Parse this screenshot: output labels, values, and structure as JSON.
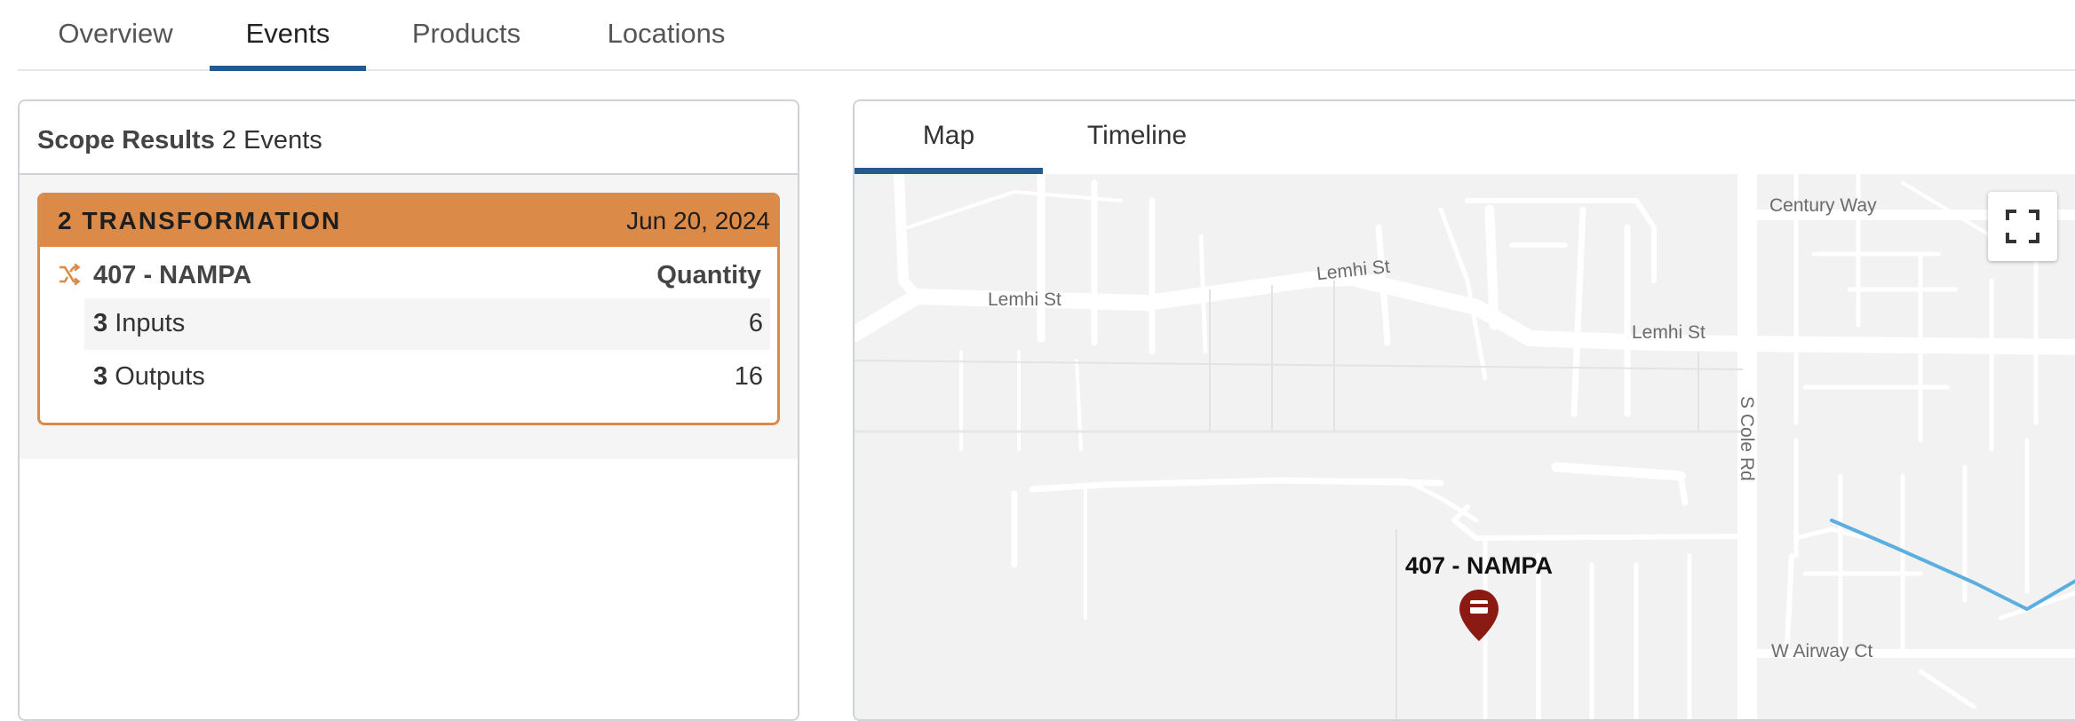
{
  "top_tabs": [
    {
      "label": "Overview"
    },
    {
      "label": "Events"
    },
    {
      "label": "Products"
    },
    {
      "label": "Locations"
    }
  ],
  "scope": {
    "title": "Scope Results",
    "count": "2 Events"
  },
  "event": {
    "type": "2 TRANSFORMATION",
    "date": "Jun 20, 2024",
    "location": "407 - NAMPA",
    "quantity_label": "Quantity",
    "inputs": {
      "count": "3",
      "label": " Inputs",
      "value": "6"
    },
    "outputs": {
      "count": "3",
      "label": " Outputs",
      "value": "16"
    },
    "accent_color": "#dc8a47"
  },
  "map_tabs": [
    {
      "label": "Map"
    },
    {
      "label": "Timeline"
    }
  ],
  "map": {
    "streets": {
      "century": "Century Way",
      "lemhi_1": "Lemhi St",
      "lemhi_2": "Lemhi St",
      "lemhi_3": "Lemhi St",
      "cole": "S Cole Rd",
      "airway": "W Airway Ct"
    },
    "marker_label": "407 - NAMPA",
    "marker_color": "#8b1a12",
    "fullscreen_icon": "fullscreen-icon"
  }
}
